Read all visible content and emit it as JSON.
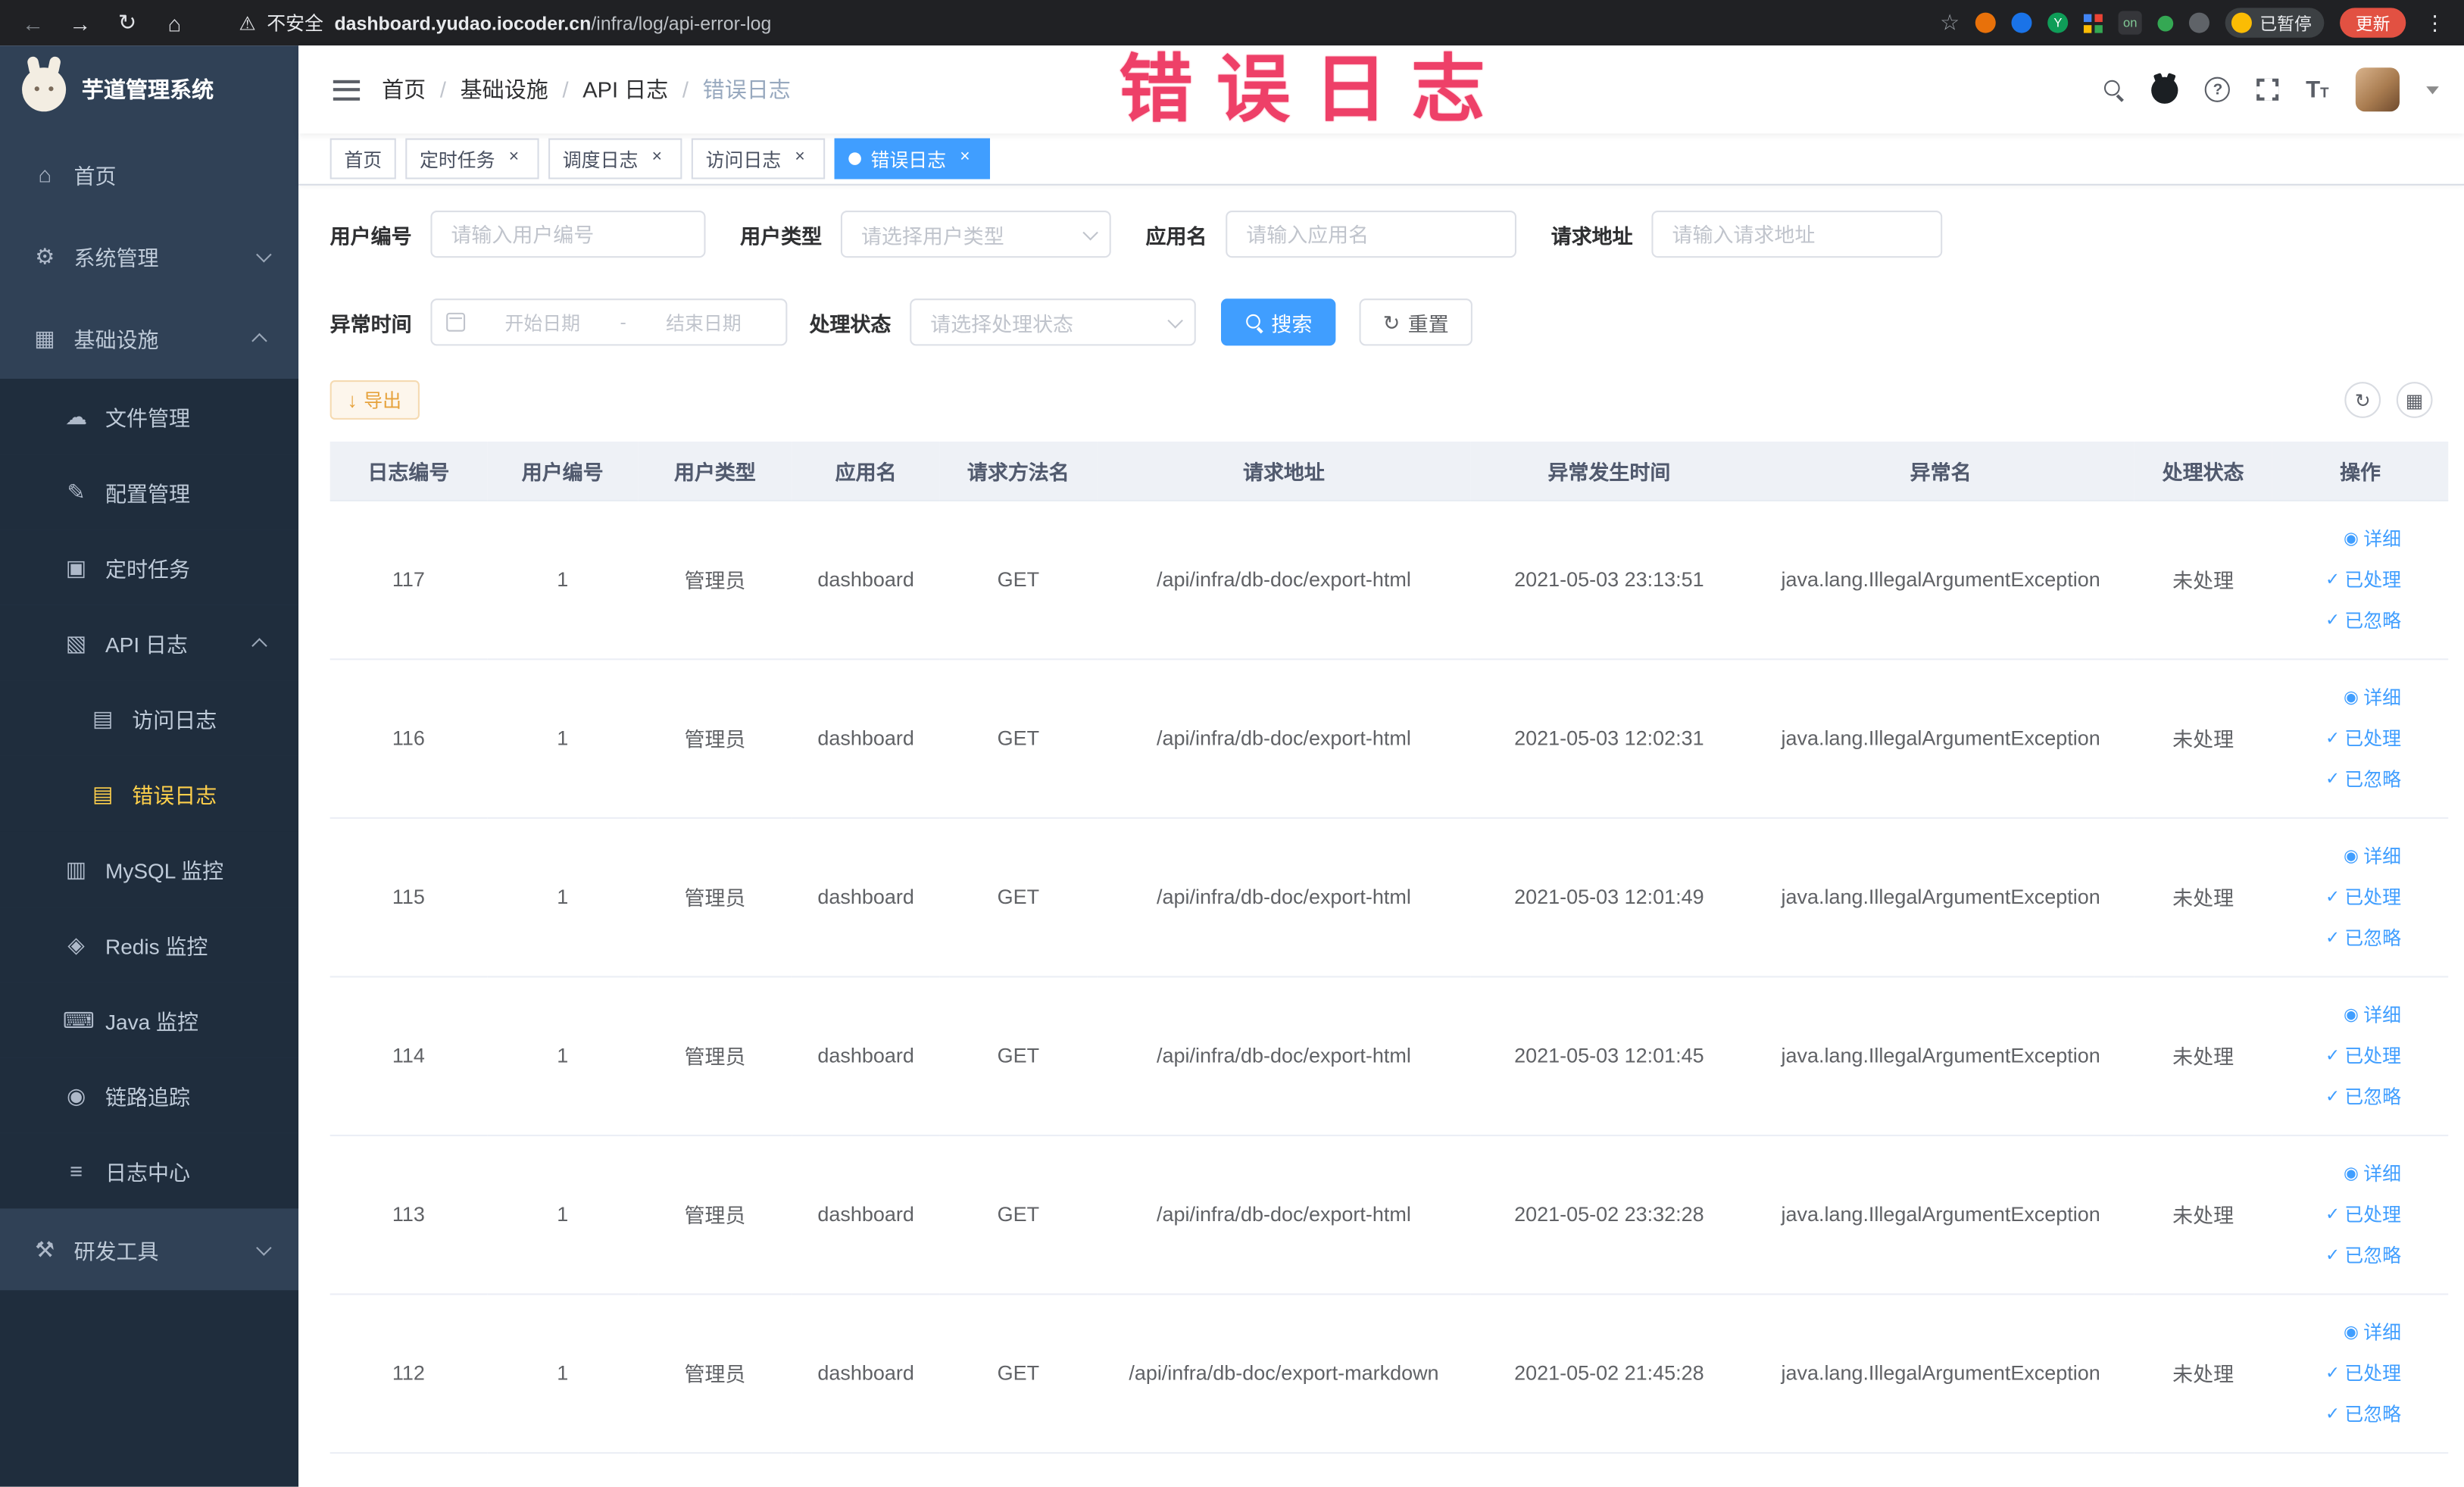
{
  "browser": {
    "security_label": "不安全",
    "url_host": "dashboard.yudao.iocoder.cn",
    "url_path": "/infra/log/api-error-log",
    "ext_on_badge": "on",
    "ext_y_badge": "Y",
    "paused_badge": "已暂停",
    "update_button": "更新"
  },
  "watermark": "错误日志",
  "icons": {
    "back": "←",
    "forward": "→",
    "reload": "↻",
    "home": "⌂",
    "warning": "⚠",
    "star": "☆",
    "dots": "⋮",
    "menu_home": "⌂",
    "gear": "⚙",
    "infra": "▦",
    "file": "☁",
    "config": "✎",
    "job": "▣",
    "api_log": "▧",
    "doc": "▤",
    "mysql": "▥",
    "redis": "◈",
    "java": "⌨",
    "trace": "◉",
    "log_center": "≡",
    "tool": "⚒",
    "download": "↓",
    "refresh": "↻",
    "columns": "▦",
    "eye": "◉",
    "check": "✓",
    "close": "×",
    "question": "?"
  },
  "sidebar": {
    "logo_title": "芋道管理系统",
    "items": [
      {
        "label": "首页"
      },
      {
        "label": "系统管理"
      },
      {
        "label": "基础设施"
      },
      {
        "label": "文件管理"
      },
      {
        "label": "配置管理"
      },
      {
        "label": "定时任务"
      },
      {
        "label": "API 日志"
      },
      {
        "label": "访问日志"
      },
      {
        "label": "错误日志"
      },
      {
        "label": "MySQL 监控"
      },
      {
        "label": "Redis 监控"
      },
      {
        "label": "Java 监控"
      },
      {
        "label": "链路追踪"
      },
      {
        "label": "日志中心"
      },
      {
        "label": "研发工具"
      }
    ]
  },
  "header": {
    "breadcrumb": [
      "首页",
      "基础设施",
      "API 日志",
      "错误日志"
    ]
  },
  "tabs": [
    {
      "label": "首页"
    },
    {
      "label": "定时任务"
    },
    {
      "label": "调度日志"
    },
    {
      "label": "访问日志"
    },
    {
      "label": "错误日志"
    }
  ],
  "filters": {
    "user_id_label": "用户编号",
    "user_id_placeholder": "请输入用户编号",
    "user_type_label": "用户类型",
    "user_type_placeholder": "请选择用户类型",
    "app_name_label": "应用名",
    "app_name_placeholder": "请输入应用名",
    "request_url_label": "请求地址",
    "request_url_placeholder": "请输入请求地址",
    "exception_time_label": "异常时间",
    "date_start_placeholder": "开始日期",
    "date_separator": "-",
    "date_end_placeholder": "结束日期",
    "process_status_label": "处理状态",
    "process_status_placeholder": "请选择处理状态",
    "search_button": "搜索",
    "reset_button": "重置"
  },
  "toolbar": {
    "export_button": "导出"
  },
  "table": {
    "columns": [
      "日志编号",
      "用户编号",
      "用户类型",
      "应用名",
      "请求方法名",
      "请求地址",
      "异常发生时间",
      "异常名",
      "处理状态",
      "操作"
    ],
    "row_actions": {
      "detail": "详细",
      "processed": "已处理",
      "ignored": "已忽略"
    },
    "rows": [
      {
        "log_id": "117",
        "user_id": "1",
        "user_type": "管理员",
        "app_name": "dashboard",
        "method": "GET",
        "url": "/api/infra/db-doc/export-html",
        "time": "2021-05-03 23:13:51",
        "exception": "java.lang.IllegalArgumentException",
        "status": "未处理"
      },
      {
        "log_id": "116",
        "user_id": "1",
        "user_type": "管理员",
        "app_name": "dashboard",
        "method": "GET",
        "url": "/api/infra/db-doc/export-html",
        "time": "2021-05-03 12:02:31",
        "exception": "java.lang.IllegalArgumentException",
        "status": "未处理"
      },
      {
        "log_id": "115",
        "user_id": "1",
        "user_type": "管理员",
        "app_name": "dashboard",
        "method": "GET",
        "url": "/api/infra/db-doc/export-html",
        "time": "2021-05-03 12:01:49",
        "exception": "java.lang.IllegalArgumentException",
        "status": "未处理"
      },
      {
        "log_id": "114",
        "user_id": "1",
        "user_type": "管理员",
        "app_name": "dashboard",
        "method": "GET",
        "url": "/api/infra/db-doc/export-html",
        "time": "2021-05-03 12:01:45",
        "exception": "java.lang.IllegalArgumentException",
        "status": "未处理"
      },
      {
        "log_id": "113",
        "user_id": "1",
        "user_type": "管理员",
        "app_name": "dashboard",
        "method": "GET",
        "url": "/api/infra/db-doc/export-html",
        "time": "2021-05-02 23:32:28",
        "exception": "java.lang.IllegalArgumentException",
        "status": "未处理"
      },
      {
        "log_id": "112",
        "user_id": "1",
        "user_type": "管理员",
        "app_name": "dashboard",
        "method": "GET",
        "url": "/api/infra/db-doc/export-markdown",
        "time": "2021-05-02 21:45:28",
        "exception": "java.lang.IllegalArgumentException",
        "status": "未处理"
      }
    ]
  },
  "colors": {
    "primary": "#409eff",
    "warning": "#e6a23c",
    "sidebar_bg": "#304156",
    "sidebar_submenu_bg": "#1f2d3d",
    "sidebar_active_text": "#ffd04b",
    "watermark": "#ee4068",
    "update_badge": "#e25142"
  }
}
